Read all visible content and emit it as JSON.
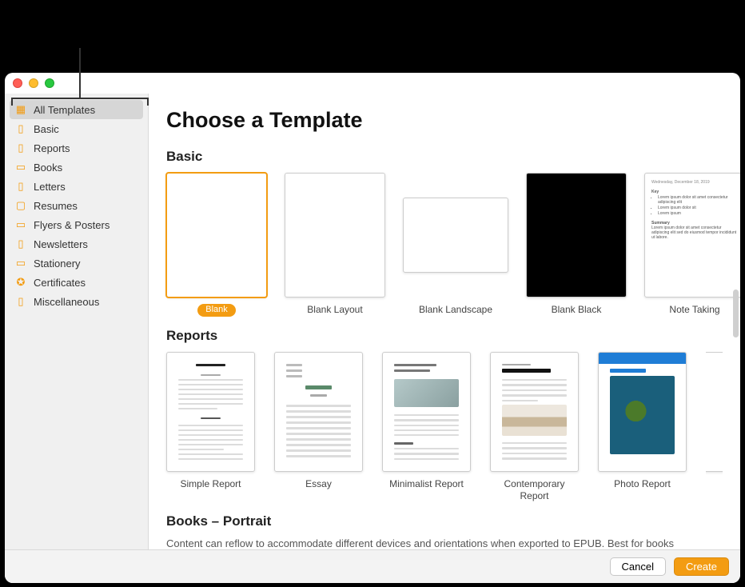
{
  "header": {
    "title": "Choose a Template"
  },
  "sidebar": {
    "items": [
      {
        "label": "All Templates",
        "icon": "grid-icon",
        "selected": true
      },
      {
        "label": "Basic",
        "icon": "page-icon"
      },
      {
        "label": "Reports",
        "icon": "page-icon"
      },
      {
        "label": "Books",
        "icon": "book-icon"
      },
      {
        "label": "Letters",
        "icon": "page-icon"
      },
      {
        "label": "Resumes",
        "icon": "person-icon"
      },
      {
        "label": "Flyers & Posters",
        "icon": "spread-icon"
      },
      {
        "label": "Newsletters",
        "icon": "page-icon"
      },
      {
        "label": "Stationery",
        "icon": "card-icon"
      },
      {
        "label": "Certificates",
        "icon": "ribbon-icon"
      },
      {
        "label": "Miscellaneous",
        "icon": "page-icon"
      }
    ]
  },
  "sections": {
    "basic": {
      "title": "Basic",
      "templates": [
        {
          "name": "Blank",
          "selected": true
        },
        {
          "name": "Blank Layout"
        },
        {
          "name": "Blank Landscape"
        },
        {
          "name": "Blank Black"
        },
        {
          "name": "Note Taking"
        }
      ]
    },
    "reports": {
      "title": "Reports",
      "templates": [
        {
          "name": "Simple Report"
        },
        {
          "name": "Essay"
        },
        {
          "name": "Minimalist Report"
        },
        {
          "name": "Contemporary Report"
        },
        {
          "name": "Photo Report"
        }
      ]
    },
    "books": {
      "title": "Books – Portrait",
      "subtitle": "Content can reflow to accommodate different devices and orientations when exported to EPUB. Best for books"
    }
  },
  "footer": {
    "cancel": "Cancel",
    "create": "Create"
  },
  "accent_color": "#f39c12"
}
